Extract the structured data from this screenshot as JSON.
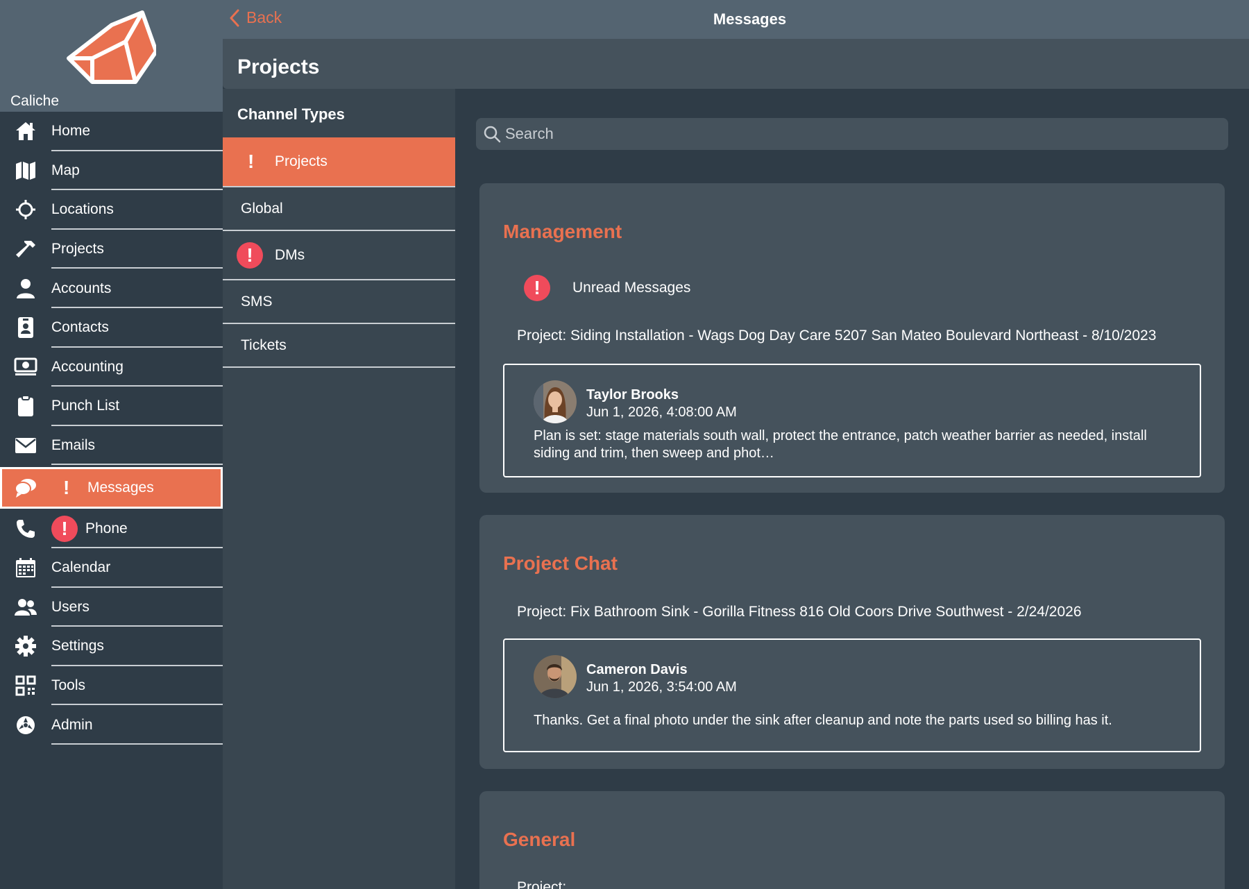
{
  "app": {
    "name": "Caliche"
  },
  "topbar": {
    "back_label": "Back",
    "title": "Messages"
  },
  "page": {
    "title": "Projects"
  },
  "sidebar": {
    "items": [
      {
        "label": "Home",
        "icon": "home-icon"
      },
      {
        "label": "Map",
        "icon": "map-icon"
      },
      {
        "label": "Locations",
        "icon": "crosshair-icon"
      },
      {
        "label": "Projects",
        "icon": "hammer-icon"
      },
      {
        "label": "Accounts",
        "icon": "person-icon"
      },
      {
        "label": "Contacts",
        "icon": "contact-badge-icon"
      },
      {
        "label": "Accounting",
        "icon": "money-icon"
      },
      {
        "label": "Punch List",
        "icon": "clipboard-icon"
      },
      {
        "label": "Emails",
        "icon": "envelope-icon"
      },
      {
        "label": "Messages",
        "icon": "chat-bubble-icon",
        "active": true,
        "alert": "!"
      },
      {
        "label": "Phone",
        "icon": "phone-icon",
        "alert": "!"
      },
      {
        "label": "Calendar",
        "icon": "calendar-icon"
      },
      {
        "label": "Users",
        "icon": "users-icon"
      },
      {
        "label": "Settings",
        "icon": "gear-icon"
      },
      {
        "label": "Tools",
        "icon": "qr-grid-icon"
      },
      {
        "label": "Admin",
        "icon": "admin-icon"
      }
    ]
  },
  "channels": {
    "title": "Channel Types",
    "items": [
      {
        "label": "Projects",
        "active": true,
        "alert": "!"
      },
      {
        "label": "Global"
      },
      {
        "label": "DMs",
        "alert": "!"
      },
      {
        "label": "SMS"
      },
      {
        "label": "Tickets"
      }
    ]
  },
  "search": {
    "placeholder": "Search"
  },
  "sections": {
    "management": {
      "title": "Management",
      "unread_label": "Unread Messages",
      "alert": "!",
      "project": "Project: Siding Installation - Wags Dog Day Care 5207 San Mateo Boulevard Northeast - 8/10/2023",
      "message": {
        "author": "Taylor Brooks",
        "time": "Jun 1, 2026, 4:08:00 AM",
        "body": "Plan is set: stage materials south wall, protect the entrance, patch weather barrier as needed, install siding and trim, then sweep and phot…"
      }
    },
    "project_chat": {
      "title": "Project Chat",
      "project": "Project: Fix Bathroom Sink - Gorilla Fitness 816 Old Coors Drive Southwest - 2/24/2026",
      "message": {
        "author": "Cameron Davis",
        "time": "Jun 1, 2026, 3:54:00 AM",
        "body": "Thanks. Get a final photo under the sink after cleanup and note the parts used so billing has it."
      }
    },
    "general": {
      "title": "General",
      "project": "Project:"
    }
  },
  "colors": {
    "accent": "#e97150",
    "alert": "#f04b5b",
    "background": "#2f3c47",
    "card": "#45525c",
    "header": "#546471"
  }
}
